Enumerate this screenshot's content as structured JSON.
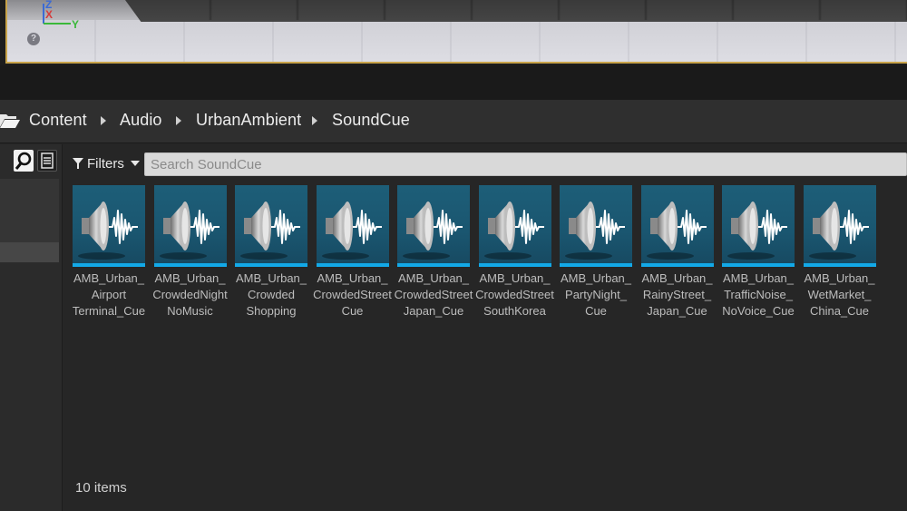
{
  "viewport": {
    "axis": {
      "z": "Z",
      "x": "X",
      "y": "Y"
    },
    "help_glyph": "?"
  },
  "breadcrumb": {
    "icon": "folder-open-icon",
    "items": [
      "Content",
      "Audio",
      "UrbanAmbient",
      "SoundCue"
    ]
  },
  "toolbar": {
    "filters_label": "Filters",
    "filter_icon": "funnel-icon",
    "search_placeholder": "Search SoundCue"
  },
  "assets": [
    {
      "label": "AMB_Urban_\nAirport\nTerminal_Cue"
    },
    {
      "label": "AMB_Urban_\nCrowdedNight\nNoMusic"
    },
    {
      "label": "AMB_Urban_\nCrowded\nShopping"
    },
    {
      "label": "AMB_Urban_\nCrowdedStreet\nCue"
    },
    {
      "label": "AMB_Urban_\nCrowdedStreet\nJapan_Cue"
    },
    {
      "label": "AMB_Urban_\nCrowdedStreet\nSouthKorea"
    },
    {
      "label": "AMB_Urban_\nPartyNight_\nCue"
    },
    {
      "label": "AMB_Urban_\nRainyStreet_\nJapan_Cue"
    },
    {
      "label": "AMB_Urban_\nTrafficNoise_\nNoVoice_Cue"
    },
    {
      "label": "AMB_Urban_\nWetMarket_\nChina_Cue"
    }
  ],
  "asset_icon": "speaker-waveform-icon",
  "status": {
    "item_count": "10 items"
  },
  "colors": {
    "thumb_bg": "#1d5e78",
    "thumb_accent": "#12a9e8",
    "viewport_border": "#c9a44a"
  }
}
